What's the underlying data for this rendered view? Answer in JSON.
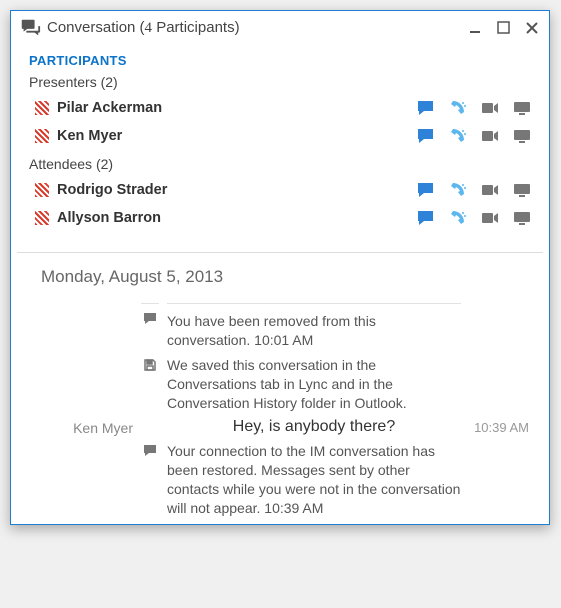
{
  "window": {
    "title": "Conversation (",
    "participant_count": "4",
    "title_suffix": " Participants)"
  },
  "participants": {
    "heading": "PARTICIPANTS",
    "presenters_label": "Presenters",
    "presenters_count": "(2)",
    "attendees_label": "Attendees",
    "attendees_count": "(2)",
    "presenters": [
      {
        "name": "Pilar Ackerman"
      },
      {
        "name": "Ken Myer"
      }
    ],
    "attendees": [
      {
        "name": "Rodrigo Strader"
      },
      {
        "name": "Allyson Barron"
      }
    ]
  },
  "conversation": {
    "date": "Monday, August 5, 2013",
    "sys1": "You have been removed from this conversation. 10:01 AM",
    "sys2": "We saved this conversation in the Conversations tab in Lync and in the Conversation History folder in Outlook.",
    "msg_sender": "Ken Myer",
    "msg_text": "Hey, is anybody there?",
    "msg_time": "10:39 AM",
    "sys3": "Your connection to the IM conversation has been restored. Messages sent by other contacts while you were not in the conversation will not appear. 10:39 AM"
  }
}
